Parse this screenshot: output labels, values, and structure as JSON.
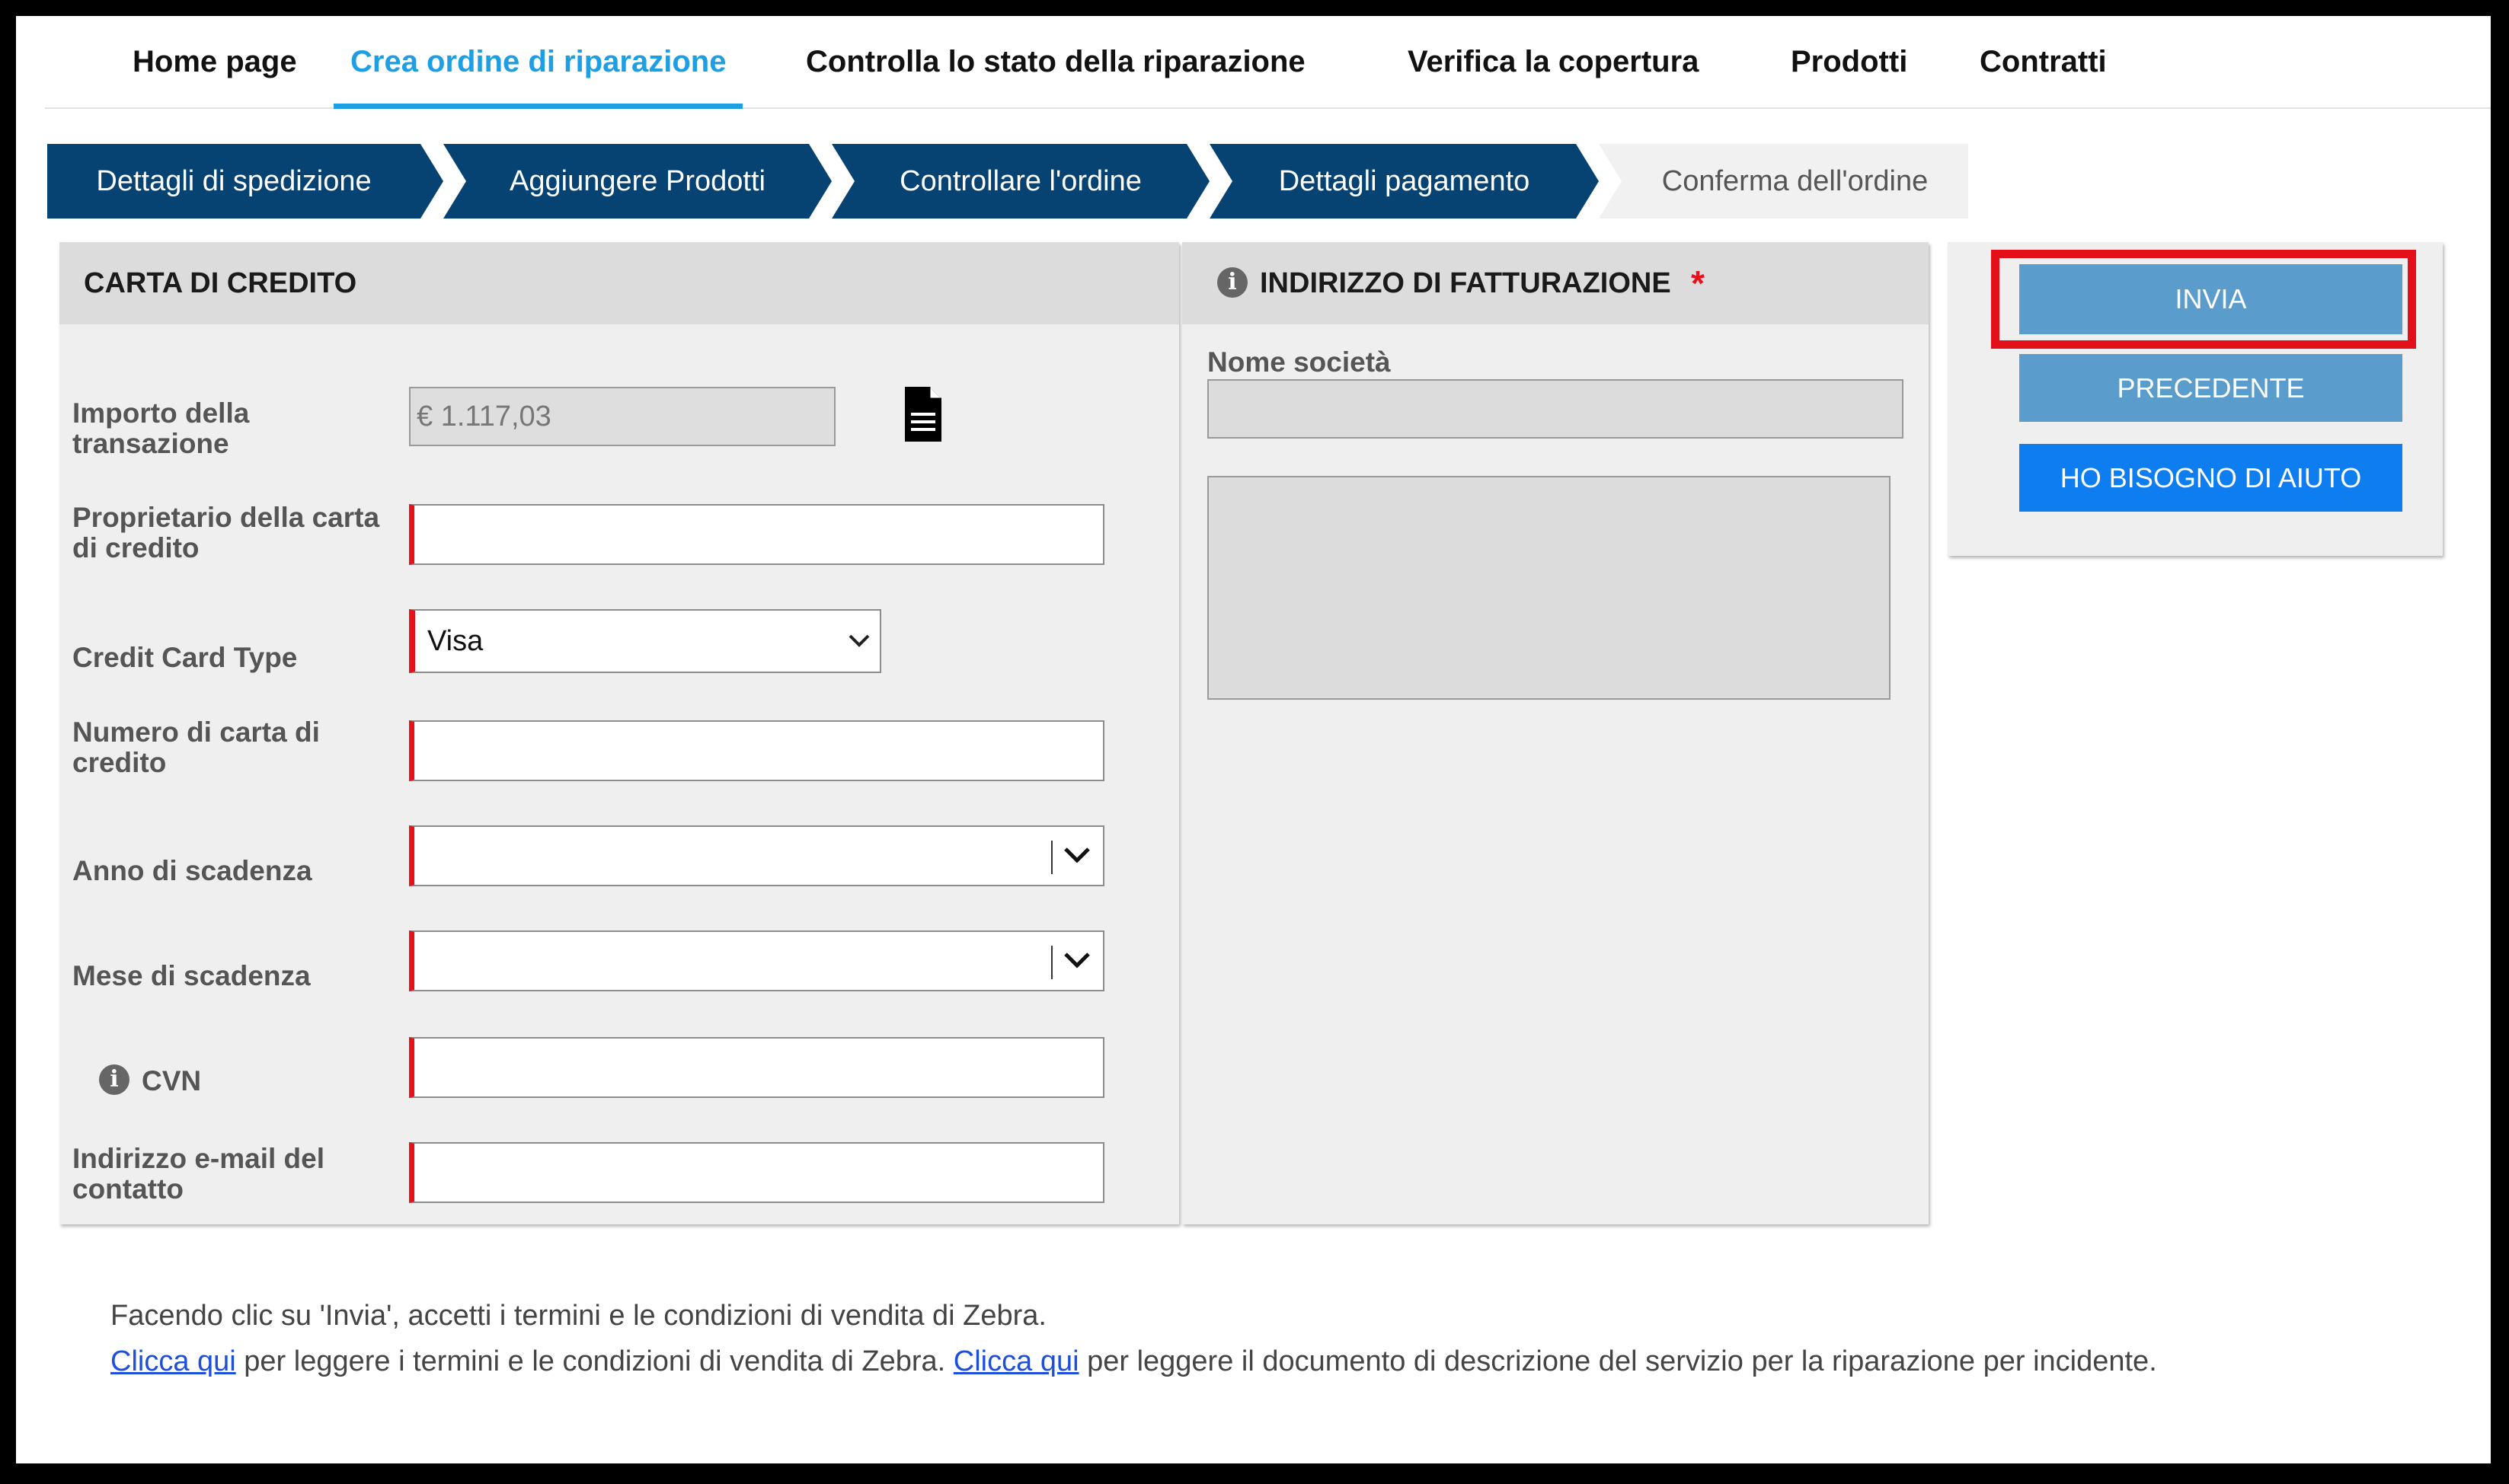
{
  "nav": {
    "items": [
      {
        "label": "Home page"
      },
      {
        "label": "Crea ordine di riparazione"
      },
      {
        "label": "Controlla lo stato della riparazione"
      },
      {
        "label": "Verifica la copertura"
      },
      {
        "label": "Prodotti"
      },
      {
        "label": "Contratti"
      }
    ],
    "active_index": 1
  },
  "steps": [
    {
      "label": "Dettagli di spedizione",
      "state": "done"
    },
    {
      "label": "Aggiungere Prodotti",
      "state": "done"
    },
    {
      "label": "Controllare l'ordine",
      "state": "done"
    },
    {
      "label": "Dettagli pagamento",
      "state": "current"
    },
    {
      "label": "Conferma dell'ordine",
      "state": "pending"
    }
  ],
  "credit_card": {
    "title": "CARTA DI CREDITO",
    "amount_label": "Importo della transazione",
    "amount_value": "€ 1.117,03",
    "owner_label": "Proprietario della carta di credito",
    "owner_value": "",
    "type_label": "Credit Card Type",
    "type_value": "Visa",
    "number_label": "Numero di carta di credito",
    "number_value": "",
    "year_label": "Anno di scadenza",
    "year_value": "",
    "month_label": "Mese di scadenza",
    "month_value": "",
    "cvn_label": "CVN",
    "cvn_value": "",
    "email_label": "Indirizzo e-mail del contatto",
    "email_value": ""
  },
  "billing": {
    "title": "INDIRIZZO DI FATTURAZIONE",
    "required_mark": "*",
    "company_label": "Nome società",
    "company_value": "",
    "address_value": ""
  },
  "actions": {
    "submit_label": "INVIA",
    "previous_label": "PRECEDENTE",
    "help_label": "HO BISOGNO DI AIUTO"
  },
  "footer": {
    "line1": "Facendo clic su 'Invia', accetti i termini e le condizioni di vendita di Zebra.",
    "link1": "Clicca qui",
    "text1": " per leggere i termini e le condizioni di vendita di Zebra. ",
    "link2": "Clicca qui",
    "text2": " per leggere il documento di descrizione del servizio per la riparazione per incidente."
  },
  "colors": {
    "step_active": "#064373",
    "accent": "#1e9fe3",
    "required": "#e8101b",
    "highlight": "#e3101a",
    "button_light": "#5a9ccb",
    "button_blue": "#0d7df0"
  }
}
